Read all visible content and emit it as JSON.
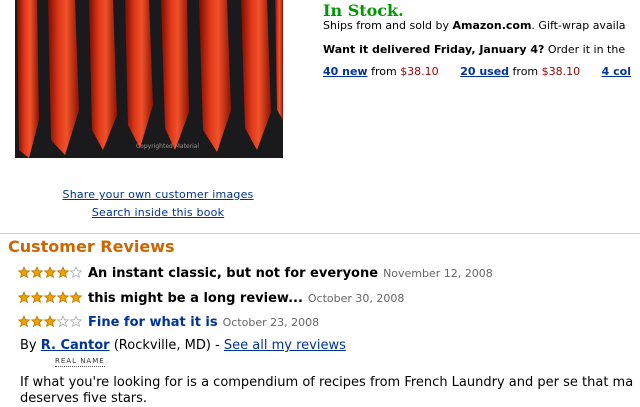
{
  "product_image": {
    "watermark": "Copyrighted Material"
  },
  "image_links": {
    "share": "Share your own customer images",
    "search_inside": "Search inside this book"
  },
  "availability": {
    "status": "In Stock.",
    "status_color": "#009900",
    "ships_prefix": "Ships from and sold by ",
    "seller": "Amazon.com",
    "ships_suffix": ". Gift-wrap availa",
    "delivery_bold": "Want it delivered Friday, January 4?",
    "delivery_rest": " Order it in the"
  },
  "offers": [
    {
      "link": "40 new",
      "from": " from ",
      "price": "$38.10"
    },
    {
      "link": "20 used",
      "from": " from ",
      "price": "$38.10"
    },
    {
      "link": "4 col"
    }
  ],
  "customer_reviews": {
    "heading": "Customer Reviews",
    "heading_color": "#cc6600",
    "reviews": [
      {
        "stars": 4,
        "title": "An instant classic, but not for everyone",
        "date": "November 12, 2008"
      },
      {
        "stars": 5,
        "title": "this might be a long review...",
        "date": "October 30, 2008"
      },
      {
        "stars": 3,
        "title": "Fine for what it is",
        "date": "October 23, 2008"
      }
    ],
    "byline": {
      "by": "By ",
      "name": "R. Cantor",
      "location": " (Rockville, MD) - ",
      "see_all": "See all my reviews",
      "badge": "REAL NAME"
    },
    "body_line1": "If what you're looking for is a compendium of recipes from French Laundry and per se that ma",
    "body_line2": "deserves five stars."
  },
  "colors": {
    "link": "#003399",
    "price": "#990000",
    "star": "#f0a000"
  }
}
